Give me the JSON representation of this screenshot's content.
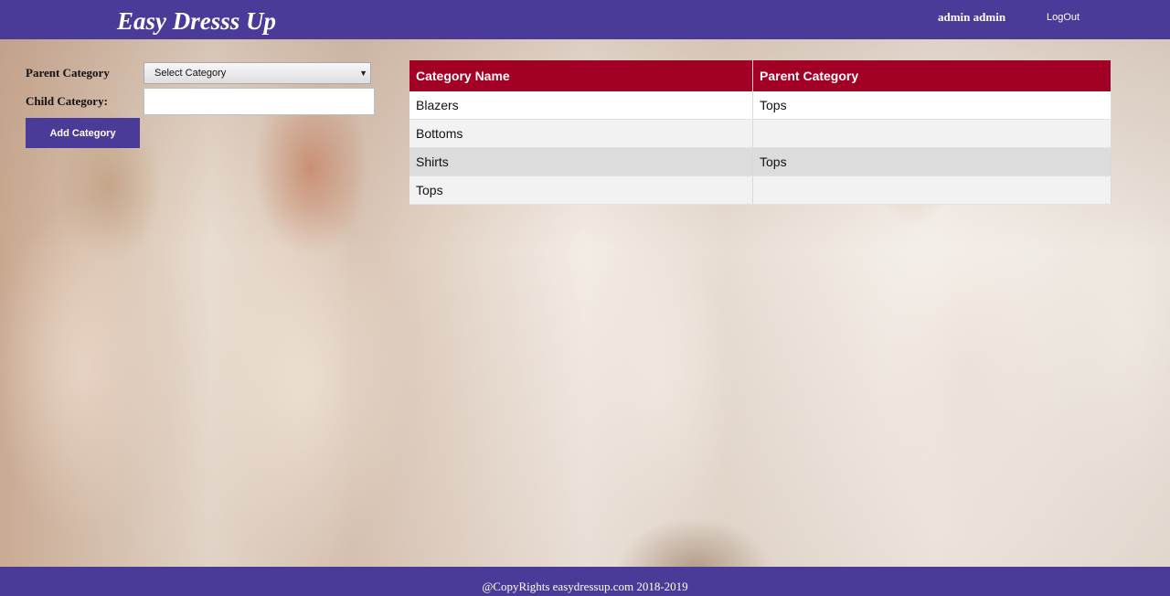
{
  "header": {
    "brand": "Easy Dresss Up",
    "user_name": "admin admin",
    "logout_label": "LogOut"
  },
  "form": {
    "parent_label": "Parent Category",
    "parent_select_value": "Select Category",
    "child_label": "Child Category:",
    "child_value": "",
    "add_button_label": "Add Category"
  },
  "table": {
    "headers": [
      "Category Name",
      "Parent Category"
    ],
    "rows": [
      {
        "name": "Blazers",
        "parent": "Tops"
      },
      {
        "name": "Bottoms",
        "parent": ""
      },
      {
        "name": "Shirts",
        "parent": "Tops"
      },
      {
        "name": "Tops",
        "parent": ""
      }
    ]
  },
  "footer": {
    "copyright": "@CopyRights easydressup.com 2018-2019"
  },
  "colors": {
    "header_bg": "#4b3b98",
    "table_header_bg": "#a30025"
  },
  "icons": {
    "select_arrow": "chevron-down-icon"
  }
}
